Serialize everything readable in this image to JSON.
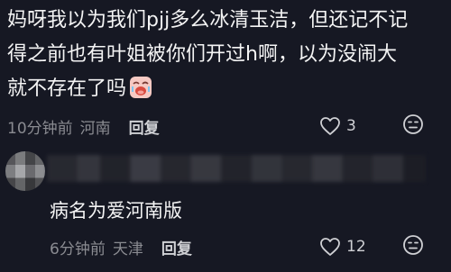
{
  "main_comment": {
    "line1": "妈呀我以为我们pjj多么冰清玉洁，但还记不记",
    "line2": "得之前也有叶姐被你们开过h啊，以为没闹大",
    "line3": "就不存在了吗",
    "emoji": "crying-face-emoji",
    "time": "10分钟前",
    "location": "河南",
    "reply_label": "回复",
    "likes": "3"
  },
  "reply_comment": {
    "text": "病名为爱河南版",
    "time": "6分钟前",
    "location": "天津",
    "reply_label": "回复",
    "likes": "12"
  },
  "icons": {
    "like": "heart-outline-icon",
    "dislike": "dislike-face-icon"
  },
  "colors": {
    "background": "#161823",
    "meta_text": "#8a8b91",
    "primary_text": "#f4f4f4"
  }
}
